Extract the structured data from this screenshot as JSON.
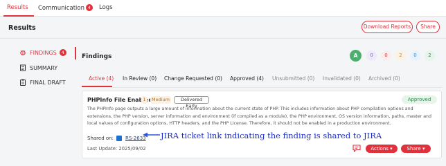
{
  "top_tabs": [
    {
      "label": "Results"
    },
    {
      "label": "Communication",
      "badge": "4"
    },
    {
      "label": "Logs"
    }
  ],
  "header": {
    "title": "Results",
    "download_label": "Download Reports",
    "share_label": "Share"
  },
  "sidebar": {
    "items": [
      {
        "label": "FINDINGS",
        "badge": "4",
        "icon": "bug-icon"
      },
      {
        "label": "SUMMARY",
        "icon": "document-icon"
      },
      {
        "label": "FINAL DRAFT",
        "icon": "clipboard-icon"
      }
    ]
  },
  "findings": {
    "title": "Findings",
    "grade": "A",
    "severity_counts": [
      {
        "value": "0",
        "color": "#7a5fc9",
        "bg": "#efeafb"
      },
      {
        "value": "0",
        "color": "#e0323c",
        "bg": "#fdecec"
      },
      {
        "value": "2",
        "color": "#e08a1e",
        "bg": "#fdf1e2"
      },
      {
        "value": "0",
        "color": "#2f8fd8",
        "bg": "#e7f2fc"
      },
      {
        "value": "2",
        "color": "#2e8b4a",
        "bg": "#e6f5ea"
      }
    ],
    "tabs": [
      {
        "label": "Active (4)"
      },
      {
        "label": "In Review (0)"
      },
      {
        "label": "Change Requested (0)"
      },
      {
        "label": "Approved (4)"
      },
      {
        "label": "Unsubmitted (0)"
      },
      {
        "label": "Invalidated (0)"
      },
      {
        "label": "Archived (0)"
      }
    ]
  },
  "card": {
    "title": "PHPInfo File Enabled",
    "count": "1",
    "severity": "Medium",
    "delivery": "Delivered Early",
    "status": "Approved",
    "description": "The PHPInfo page outputs a large amount of information about the current state of PHP. This includes information about PHP compilation options and extensions, the PHP version, server information and environment (if compiled as a module), the PHP environment, OS version information, paths, master and local values of configuration options, HTTP headers, and the PHP License. Therefore, it should not be enabled in a production environment.",
    "shared_label": "Shared on:",
    "jira_ticket": "RS-2633",
    "last_update": "Last Update: 2025/09/02",
    "actions_label": "Actions",
    "share_label": "Share"
  },
  "annotation": "JIRA ticket link indicating the finding is shared to JIRA",
  "colors": {
    "accent": "#e0323c",
    "success": "#2e8b4a",
    "annotation": "#1c2ec7"
  }
}
